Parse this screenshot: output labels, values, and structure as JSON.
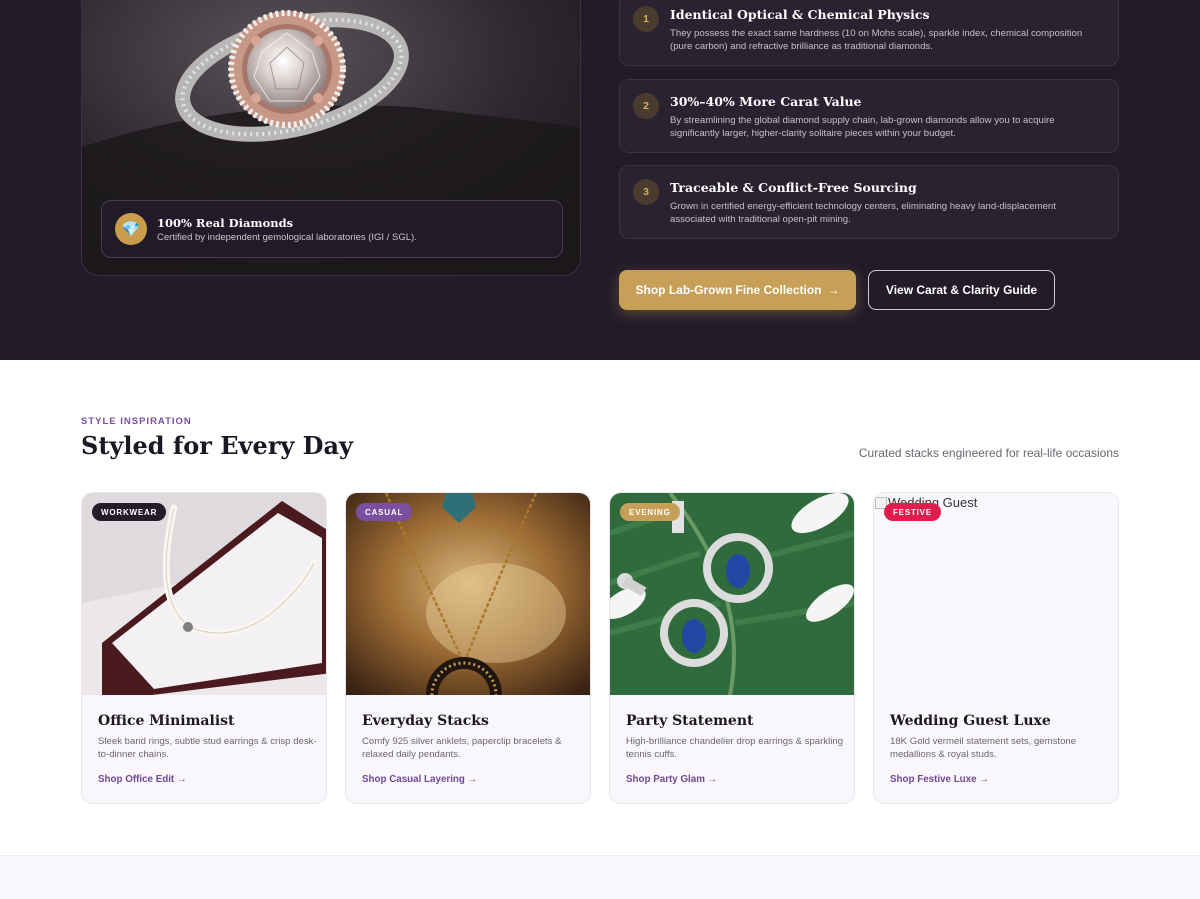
{
  "hero": {
    "cert": {
      "icon": "diamond-icon",
      "icon_glyph": "💎",
      "title": "100% Real Diamonds",
      "text": "Certified by independent gemological laboratories (IGI / SGL)."
    },
    "features": [
      {
        "num": "1",
        "title": "Identical Optical & Chemical Physics",
        "text": "They possess the exact same hardness (10 on Mohs scale), sparkle index, chemical composition (pure carbon) and refractive brilliance as traditional diamonds."
      },
      {
        "num": "2",
        "title": "30%–40% More Carat Value",
        "text": "By streamlining the global diamond supply chain, lab-grown diamonds allow you to acquire significantly larger, higher-clarity solitaire pieces within your budget."
      },
      {
        "num": "3",
        "title": "Traceable & Conflict-Free Sourcing",
        "text": "Grown in certified energy-efficient technology centers, eliminating heavy land-displacement associated with traditional open-pit mining."
      }
    ],
    "primary_button": "Shop Lab-Grown Fine Collection",
    "primary_arrow": "→",
    "secondary_button": "View Carat & Clarity Guide"
  },
  "style_section": {
    "eyebrow": "STYLE INSPIRATION",
    "title": "Styled for Every Day",
    "subtitle": "Curated stacks engineered for real-life occasions",
    "cards": [
      {
        "badge": "WORKWEAR",
        "badge_color": "#231c2a",
        "title": "Office Minimalist",
        "text": "Sleek band rings, subtle stud earrings & crisp desk-to-dinner chains.",
        "link": "Shop Office Edit →"
      },
      {
        "badge": "CASUAL",
        "badge_color": "#7a4fa0",
        "title": "Everyday Stacks",
        "text": "Comfy 925 silver anklets, paperclip bracelets & relaxed daily pendants.",
        "link": "Shop Casual Layering →"
      },
      {
        "badge": "EVENING",
        "badge_color": "#c79f57",
        "title": "Party Statement",
        "text": "High-brilliance chandelier drop earrings & sparkling tennis cuffs.",
        "link": "Shop Party Glam →"
      },
      {
        "badge": "FESTIVE",
        "badge_color": "#e01d4c",
        "title": "Wedding Guest Luxe",
        "text": "18K Gold vermeil statement sets, gemstone medallions & royal studs.",
        "link": "Shop Festive Luxe →",
        "image_alt": "Wedding Guest"
      }
    ]
  }
}
